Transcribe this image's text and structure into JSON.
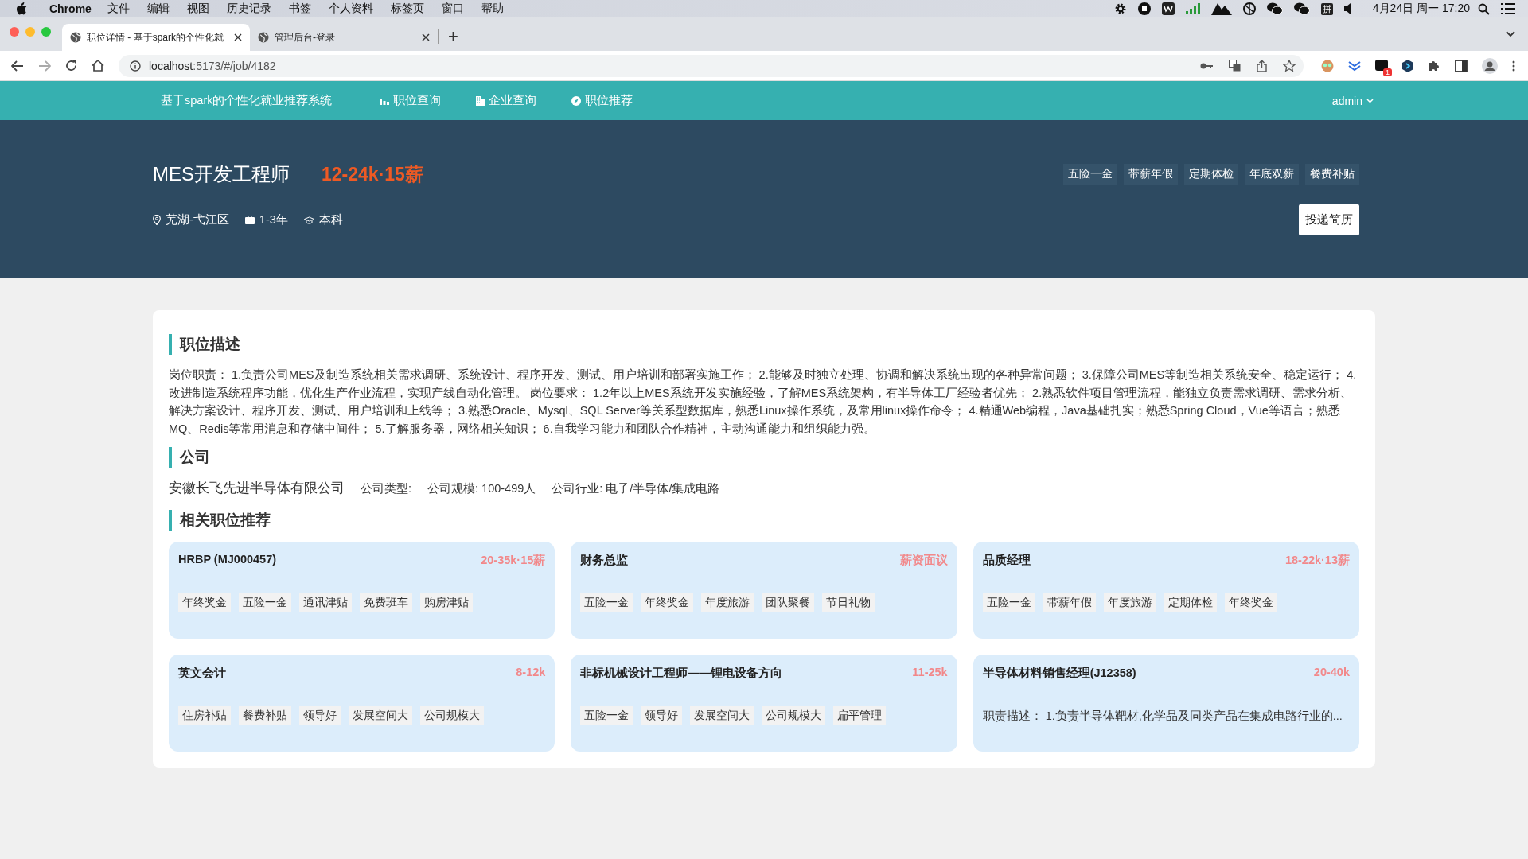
{
  "menubar": {
    "app": "Chrome",
    "menus": [
      "文件",
      "编辑",
      "视图",
      "历史记录",
      "书签",
      "个人资料",
      "标签页",
      "窗口",
      "帮助"
    ],
    "input_method": "拼",
    "clock": "4月24日 周一  17:20"
  },
  "browser": {
    "tabs": [
      {
        "title": "职位详情 - 基于spark的个性化就",
        "selected": true
      },
      {
        "title": "管理后台-登录",
        "selected": false
      }
    ],
    "new_tab": "+",
    "url_host": "localhost",
    "url_path": ":5173/#/job/4182",
    "extension_badge": "1"
  },
  "navbar": {
    "brand": "基于spark的个性化就业推荐系统",
    "links": [
      "职位查询",
      "企业查询",
      "职位推荐"
    ],
    "user": "admin"
  },
  "job": {
    "title": "MES开发工程师",
    "salary": "12-24k·15薪",
    "location": "芜湖-弋江区",
    "experience": "1-3年",
    "education": "本科",
    "benefits": [
      "五险一金",
      "带薪年假",
      "定期体检",
      "年底双薪",
      "餐费补贴"
    ],
    "apply_button": "投递简历"
  },
  "description": {
    "heading": "职位描述",
    "text": "岗位职责： 1.负责公司MES及制造系统相关需求调研、系统设计、程序开发、测试、用户培训和部署实施工作； 2.能够及时独立处理、协调和解决系统出现的各种异常问题； 3.保障公司MES等制造相关系统安全、稳定运行； 4.改进制造系统程序功能，优化生产作业流程，实现产线自动化管理。 岗位要求： 1.2年以上MES系统开发实施经验，了解MES系统架构，有半导体工厂经验者优先； 2.熟悉软件项目管理流程，能独立负责需求调研、需求分析、解决方案设计、程序开发、测试、用户培训和上线等； 3.熟悉Oracle、Mysql、SQL Server等关系型数据库，熟悉Linux操作系统，及常用linux操作命令； 4.精通Web编程，Java基础扎实；熟悉Spring Cloud，Vue等语言；熟悉MQ、Redis等常用消息和存储中间件； 5.了解服务器，网络相关知识； 6.自我学习能力和团队合作精神，主动沟通能力和组织能力强。"
  },
  "company": {
    "heading": "公司",
    "name": "安徽长飞先进半导体有限公司",
    "type": "公司类型:",
    "size": "公司规模: 100-499人",
    "industry": "公司行业: 电子/半导体/集成电路"
  },
  "related": {
    "heading": "相关职位推荐",
    "jobs": [
      {
        "title": "HRBP (MJ000457)",
        "salary": "20-35k·15薪",
        "kind": "tags",
        "tags": [
          "年终奖金",
          "五险一金",
          "通讯津贴",
          "免费班车",
          "购房津贴"
        ]
      },
      {
        "title": "财务总监",
        "salary": "薪资面议",
        "kind": "tags",
        "tags": [
          "五险一金",
          "年终奖金",
          "年度旅游",
          "团队聚餐",
          "节日礼物"
        ]
      },
      {
        "title": "品质经理",
        "salary": "18-22k·13薪",
        "kind": "tags",
        "tags": [
          "五险一金",
          "带薪年假",
          "年度旅游",
          "定期体检",
          "年终奖金"
        ]
      },
      {
        "title": "英文会计",
        "salary": "8-12k",
        "kind": "tags",
        "tags": [
          "住房补贴",
          "餐费补贴",
          "领导好",
          "发展空间大",
          "公司规模大"
        ]
      },
      {
        "title": "非标机械设计工程师——锂电设备方向",
        "salary": "11-25k",
        "kind": "tags",
        "tags": [
          "五险一金",
          "领导好",
          "发展空间大",
          "公司规模大",
          "扁平管理"
        ]
      },
      {
        "title": "半导体材料销售经理(J12358)",
        "salary": "20-40k",
        "kind": "description",
        "text": "职责描述： 1.负责半导体靶材,化学品及同类产品在集成电路行业的..."
      }
    ]
  }
}
